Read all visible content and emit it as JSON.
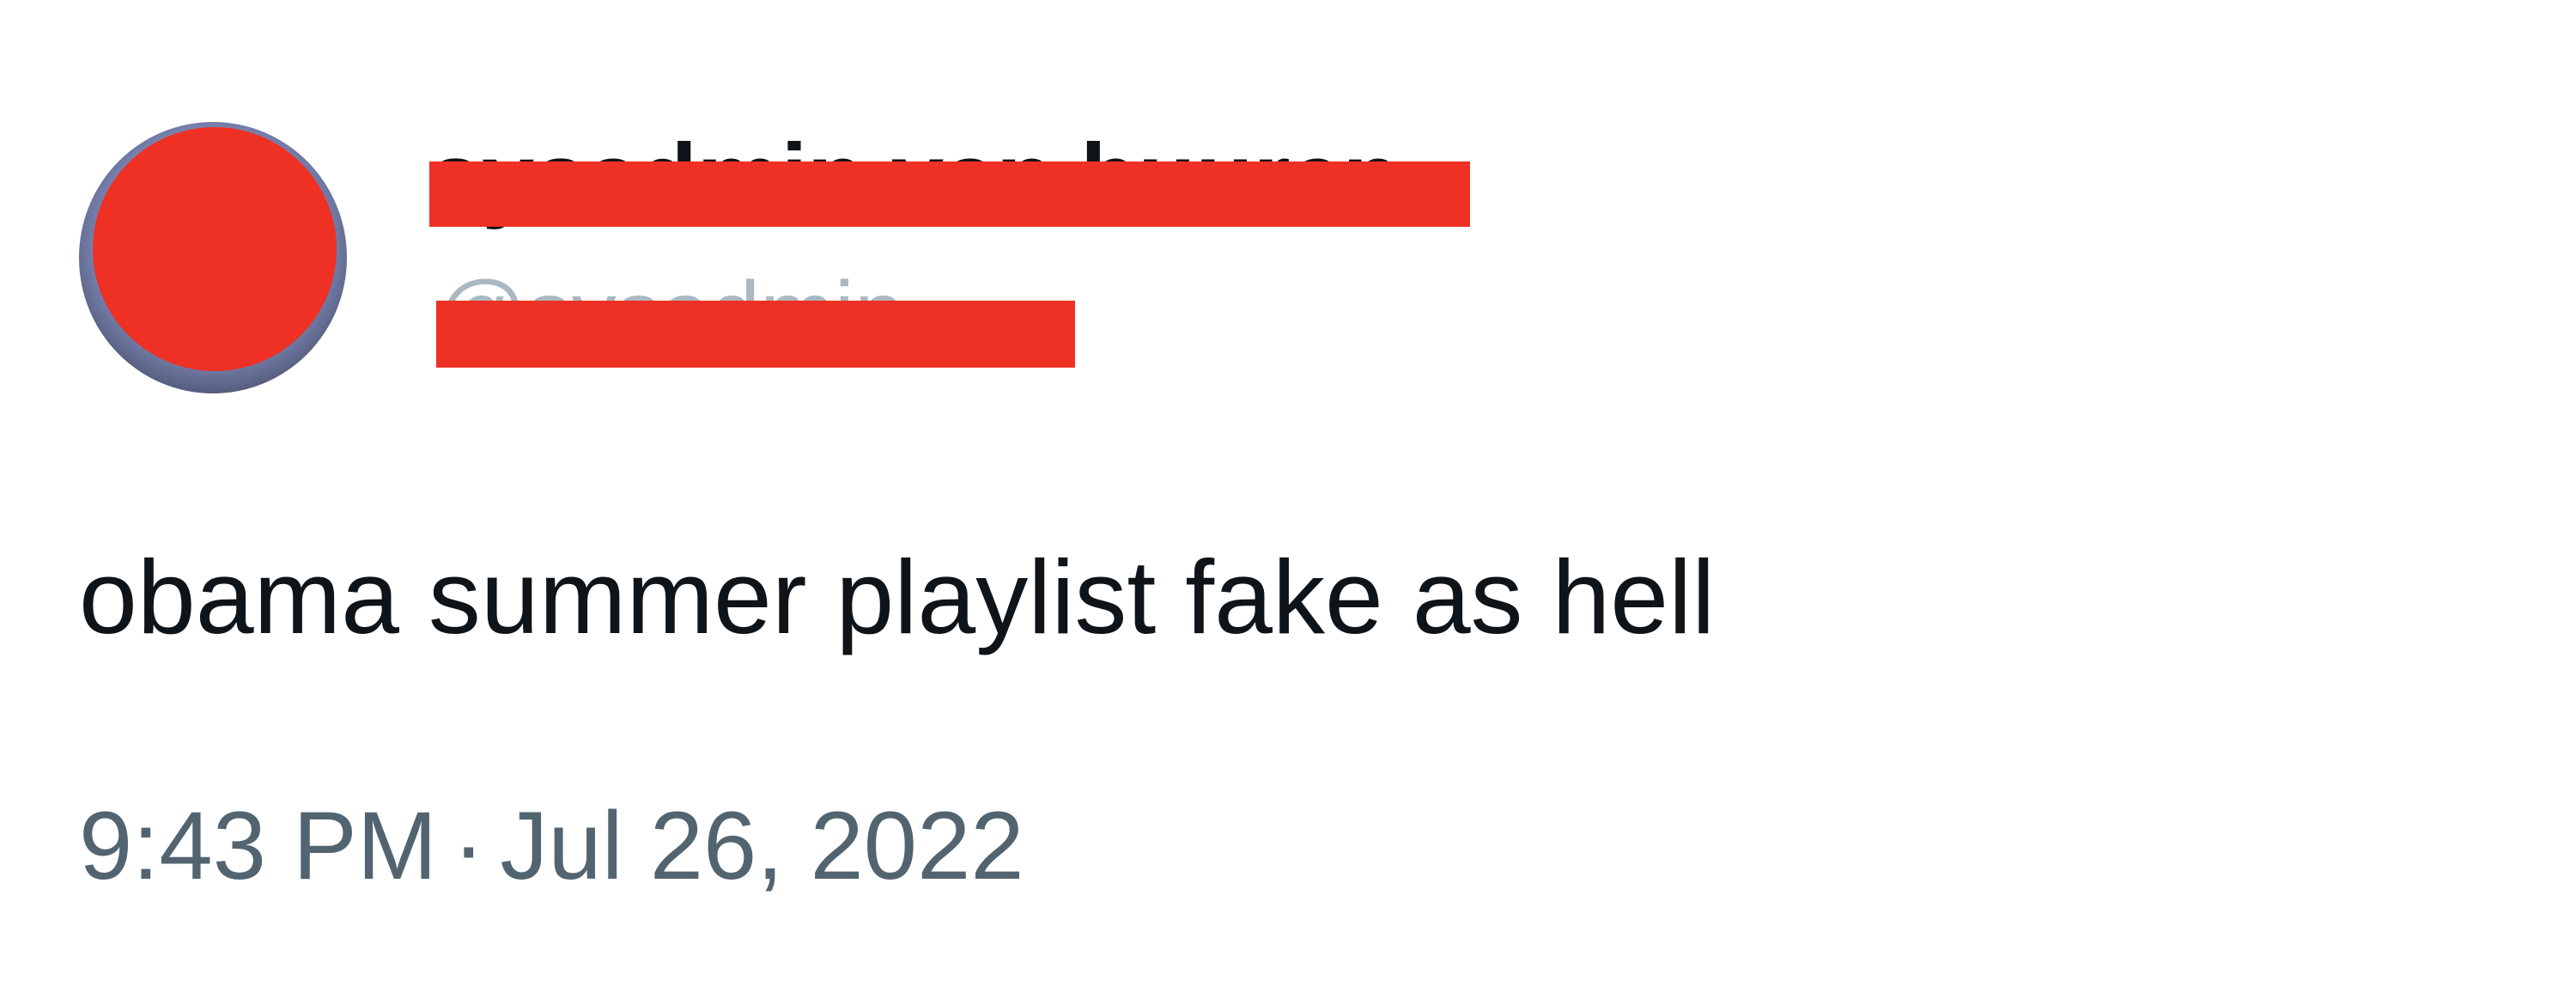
{
  "author": {
    "display_name": "sysadmin van buuren",
    "handle": "@sysadmin"
  },
  "tweet": {
    "text": "obama summer playlist fake as hell",
    "time": "9:43 PM",
    "separator": "·",
    "date": "Jul 26, 2022"
  },
  "colors": {
    "redaction": "#ee3124",
    "text_primary": "#0f1419",
    "text_secondary": "#536471",
    "background": "#ffffff"
  },
  "icons": {
    "avatar": "user-avatar-redacted"
  }
}
